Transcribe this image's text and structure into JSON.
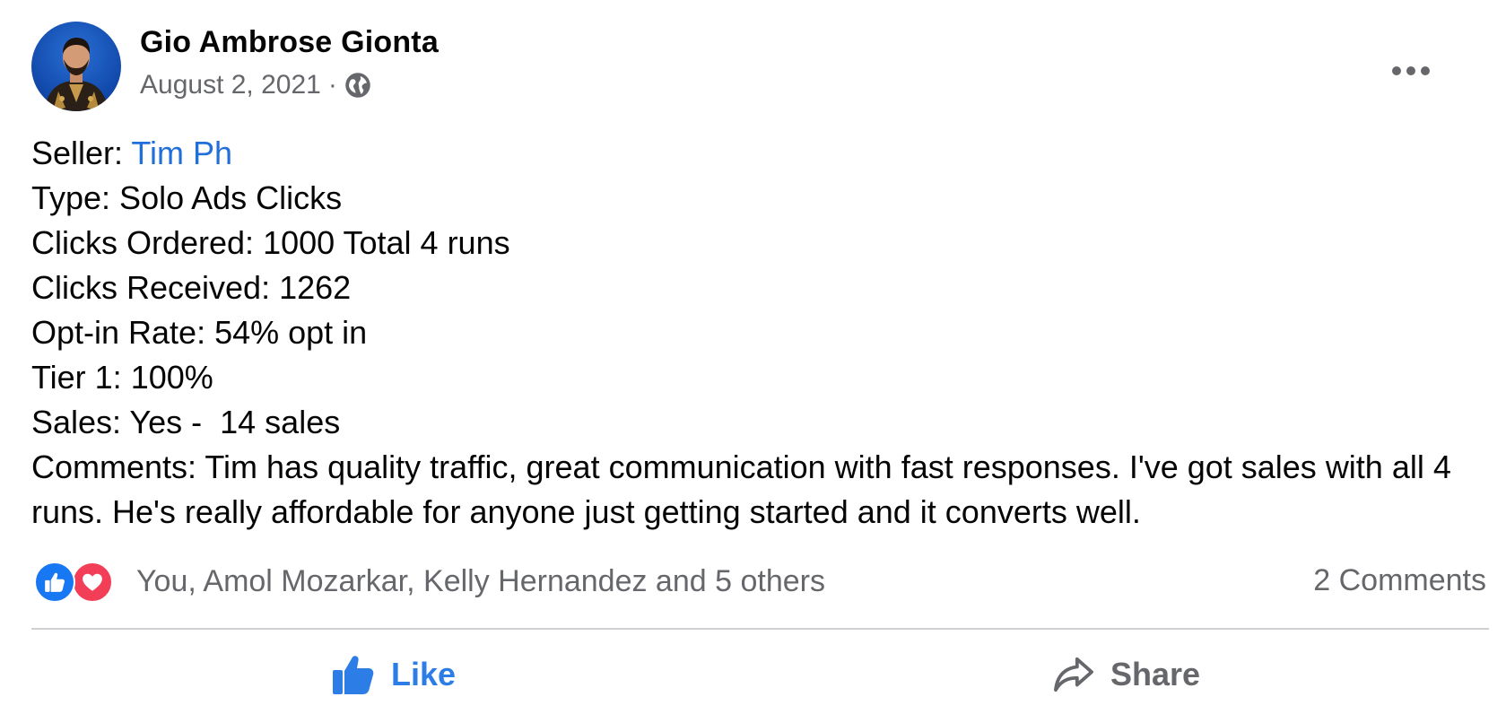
{
  "post": {
    "author": "Gio Ambrose Gionta",
    "date": "August 2, 2021",
    "separator": "·",
    "privacy_icon": "globe-icon",
    "more_icon": "ellipsis-icon"
  },
  "content": {
    "seller_label": "Seller: ",
    "seller_name": "Tim Ph",
    "lines": [
      "Type: Solo Ads Clicks",
      "Clicks Ordered: 1000 Total 4 runs",
      "Clicks Received: 1262",
      "Opt-in Rate: 54% opt in",
      "Tier 1: 100%",
      "Sales: Yes -  14 sales",
      "Comments: Tim has quality traffic, great communication with fast responses. I've got sales with all 4 runs. He's really affordable for anyone just getting started and it converts well."
    ]
  },
  "reactions": {
    "icons": [
      "like-reaction-icon",
      "love-reaction-icon"
    ],
    "summary": "You, Amol Mozarkar, Kelly Hernandez and 5 others",
    "comments_count": "2 Comments"
  },
  "actions": {
    "like_label": "Like",
    "share_label": "Share"
  },
  "colors": {
    "link": "#216fdb",
    "like_active": "#2d7de6",
    "secondary_text": "#65676b",
    "like_reaction": "#1877f2",
    "love_reaction": "#f33e58",
    "divider": "#ced0d4"
  }
}
